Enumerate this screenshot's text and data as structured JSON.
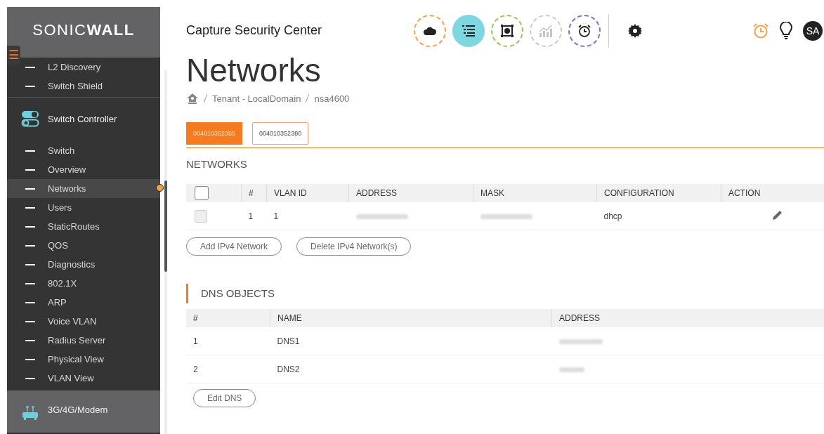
{
  "sidebar": {
    "logo": "SONIC**WALL**",
    "menu_icon": "☰",
    "items": [
      {
        "kind": "sub",
        "label": "L2 Discovery",
        "selected": false
      },
      {
        "kind": "sub",
        "label": "Switch Shield",
        "selected": false
      },
      {
        "kind": "group",
        "label": "Switch Controller",
        "selected": false
      },
      {
        "kind": "sub",
        "label": "Switch",
        "selected": false
      },
      {
        "kind": "sub",
        "label": "Overview",
        "selected": false
      },
      {
        "kind": "sub",
        "label": "Networks",
        "selected": true
      },
      {
        "kind": "sub",
        "label": "Users",
        "selected": false
      },
      {
        "kind": "sub",
        "label": "StaticRoutes",
        "selected": false
      },
      {
        "kind": "sub",
        "label": "QOS",
        "selected": false
      },
      {
        "kind": "sub",
        "label": "Diagnostics",
        "selected": false
      },
      {
        "kind": "sub",
        "label": "802.1X",
        "selected": false
      },
      {
        "kind": "sub",
        "label": "ARP",
        "selected": false
      },
      {
        "kind": "sub",
        "label": "Voice VLAN",
        "selected": false
      },
      {
        "kind": "sub",
        "label": "Radius Server",
        "selected": false
      },
      {
        "kind": "sub",
        "label": "Physical View",
        "selected": false
      },
      {
        "kind": "sub",
        "label": "VLAN View",
        "selected": false
      },
      {
        "kind": "modem",
        "label": "3G/4G/Modem",
        "selected": false
      }
    ]
  },
  "header": {
    "title": "Capture Security Center",
    "nav_icons": [
      {
        "kind": "cloud",
        "color": "#f7a14a",
        "selected": false
      },
      {
        "kind": "list",
        "color": "#7dd6e0",
        "selected": true
      },
      {
        "kind": "report",
        "color": "#9cc653",
        "selected": false
      },
      {
        "kind": "chart",
        "color": "#cccccc",
        "selected": false
      },
      {
        "kind": "clock",
        "color": "#7b73c4",
        "selected": false
      }
    ],
    "avatar": "SA"
  },
  "page": {
    "title": "Networks",
    "breadcrumb": [
      "Tenant - LocalDomain",
      "nsa4600"
    ],
    "tabs": [
      {
        "label": "004010352355",
        "selected": true
      },
      {
        "label": "004010352380",
        "selected": false
      }
    ],
    "networks": {
      "title": "NETWORKS",
      "header_checkbox": {
        "checked": false
      },
      "columns": [
        "#",
        "VLAN ID",
        "ADDRESS",
        "MASK",
        "CONFIGURATION",
        "ACTION"
      ],
      "rows": [
        {
          "checked": false,
          "index": "1",
          "vlan_id": "1",
          "configuration": "dhcp"
        }
      ],
      "buttons": [
        "Add IPv4 Network",
        "Delete IPv4 Network(s)"
      ]
    },
    "dns": {
      "title": "DNS OBJECTS",
      "columns": [
        "#",
        "NAME",
        "ADDRESS"
      ],
      "rows": [
        {
          "index": "1",
          "name": "DNS1"
        },
        {
          "index": "2",
          "name": "DNS2"
        }
      ],
      "button": "Edit DNS"
    }
  }
}
